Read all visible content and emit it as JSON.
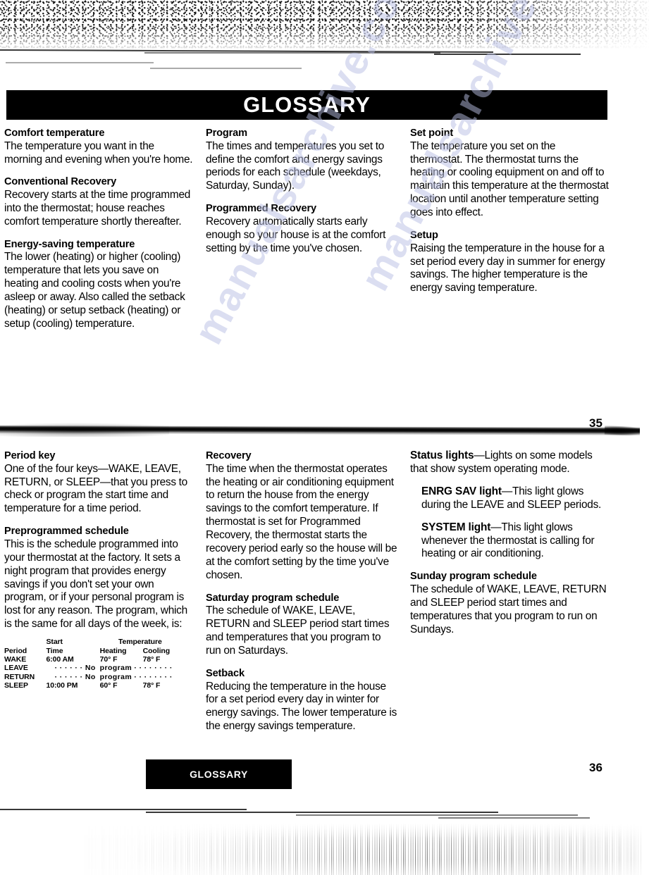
{
  "document": {
    "banner_title": "GLOSSARY",
    "footer_banner_title": "GLOSSARY",
    "page_number_first": "35",
    "page_number_second": "36",
    "watermark_line_1": "manualsarchive.com",
    "watermark_line_2": "manualsarchive.com"
  },
  "page35": {
    "col1": [
      {
        "term": "Comfort temperature",
        "def": "The temperature you want in the morning and evening when you're home."
      },
      {
        "term": "Conventional Recovery",
        "def": "Recovery starts at the time programmed into the thermostat; house reaches comfort temperature shortly thereafter."
      },
      {
        "term": "Energy-saving temperature",
        "def": "The lower (heating) or higher (cooling) temperature that lets you save on heating and cooling costs when you're asleep or away. Also called the setback (heating) or setup setback (heating) or setup (cooling) temperature."
      }
    ],
    "col2": [
      {
        "term": "Program",
        "def": "The times and temperatures you set to define the comfort and energy savings periods for each schedule (weekdays, Saturday, Sunday)."
      },
      {
        "term": "Programmed Recovery",
        "def": "Recovery automatically starts early enough so your house is at the comfort setting by the time you've chosen."
      }
    ],
    "col3": [
      {
        "term": "Set point",
        "def": "The temperature you set on the thermostat. The thermostat turns the heating or cooling equipment on and off to maintain this temperature at the thermostat location until another temperature setting goes into effect."
      },
      {
        "term": "Setup",
        "def": "Raising the temperature in the house for a set period every day in summer for energy savings. The higher temperature is the energy saving temperature."
      }
    ]
  },
  "page36": {
    "col1": [
      {
        "term": "Period key",
        "def": "One of the four keys—WAKE, LEAVE, RETURN, or SLEEP—that you press to check or program the start time and temperature for a time period."
      },
      {
        "term": "Preprogrammed schedule",
        "def": "This is the schedule programmed into your thermostat at the factory. It sets a night program that provides energy savings if you don't set your own program, or if your personal program is lost for any reason. The program, which is the same for all days of the week, is:"
      }
    ],
    "schedule_table": {
      "group_header_start": "Start",
      "group_header_temperature": "Temperature",
      "headers": [
        "Period",
        "Time",
        "Heating",
        "Cooling"
      ],
      "rows": [
        {
          "period": "WAKE",
          "time": "6:00 AM",
          "heating": "70° F",
          "cooling": "78° F",
          "no_program": false
        },
        {
          "period": "LEAVE",
          "time": "· · · · · · No",
          "heating": "program · · · · · · · ·",
          "cooling": "",
          "no_program": true
        },
        {
          "period": "RETURN",
          "time": "· · · · · · No",
          "heating": "program · · · · · · · ·",
          "cooling": "",
          "no_program": true
        },
        {
          "period": "SLEEP",
          "time": "10:00 PM",
          "heating": "60° F",
          "cooling": "78° F",
          "no_program": false
        }
      ]
    },
    "col2": [
      {
        "term": "Recovery",
        "def": "The time when the thermostat operates the heating or air conditioning equipment to return the house from the energy savings to the comfort temperature. If thermostat is set for Programmed Recovery, the thermostat starts the recovery period early so the house will be at the comfort setting by the time you've chosen."
      },
      {
        "term": "Saturday program schedule",
        "def": "The schedule of WAKE, LEAVE, RETURN and SLEEP period start times and temperatures that you program to run on Saturdays."
      },
      {
        "term": "Setback",
        "def": "Reducing the temperature in the house for a set period every day in winter for energy savings. The lower temperature is the energy savings temperature."
      }
    ],
    "col3": {
      "status_lights": {
        "lead": "Status lights",
        "rest": "—Lights on some models that show system operating mode."
      },
      "sub_entries": [
        {
          "lead": "ENRG SAV light",
          "rest": "—This light glows during the LEAVE and SLEEP periods."
        },
        {
          "lead": "SYSTEM light",
          "rest": "—This light glows whenever the thermostat is calling for heating or air conditioning."
        }
      ],
      "sunday": {
        "term": "Sunday program schedule",
        "def": "The schedule of WAKE, LEAVE, RETURN and SLEEP period start times and temperatures that you program to run on Sundays."
      }
    }
  }
}
